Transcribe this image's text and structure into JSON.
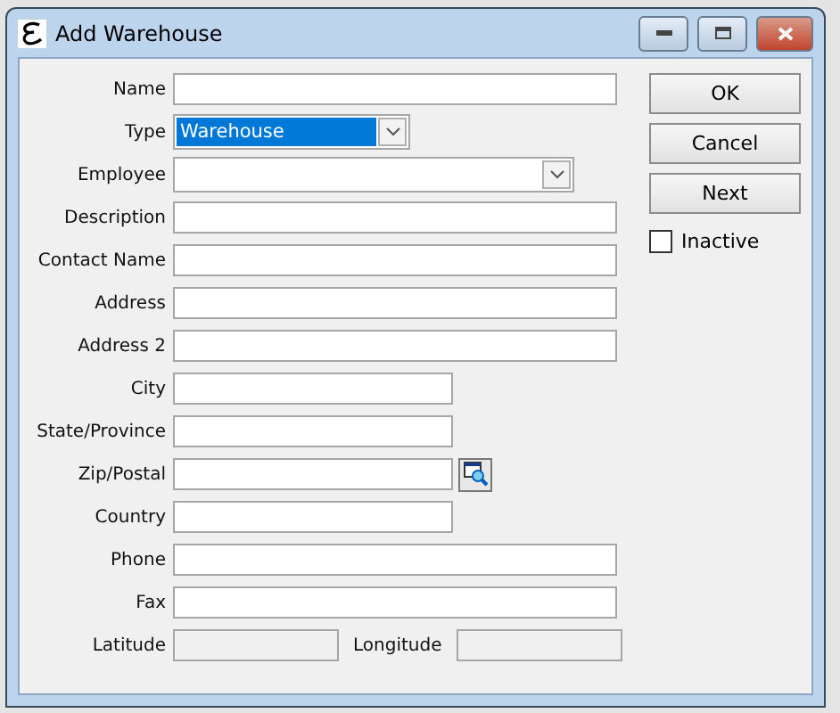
{
  "window": {
    "title": "Add Warehouse"
  },
  "fields": [
    {
      "kind": "text",
      "label": "Name"
    },
    {
      "kind": "select",
      "label": "Type",
      "value": "Warehouse",
      "highlighted": true
    },
    {
      "kind": "select_wide",
      "label": "Employee",
      "highlighted": false
    },
    {
      "kind": "text",
      "label": "Description"
    },
    {
      "kind": "text",
      "label": "Contact Name"
    },
    {
      "kind": "text",
      "label": "Address"
    },
    {
      "kind": "text",
      "label": "Address 2"
    },
    {
      "kind": "short",
      "label": "City"
    },
    {
      "kind": "short",
      "label": "State/Province"
    },
    {
      "kind": "lookup",
      "label": "Zip/Postal"
    },
    {
      "kind": "short",
      "label": "Country"
    },
    {
      "kind": "text",
      "label": "Phone"
    },
    {
      "kind": "text",
      "label": "Fax"
    },
    {
      "kind": "pair",
      "label": "Latitude",
      "disabled": true,
      "second_label": "Longitude"
    }
  ],
  "buttons": [
    {
      "label": "OK"
    },
    {
      "label": "Cancel"
    },
    {
      "label": "Next"
    }
  ],
  "inactive": {
    "label": "Inactive",
    "checked": false
  }
}
